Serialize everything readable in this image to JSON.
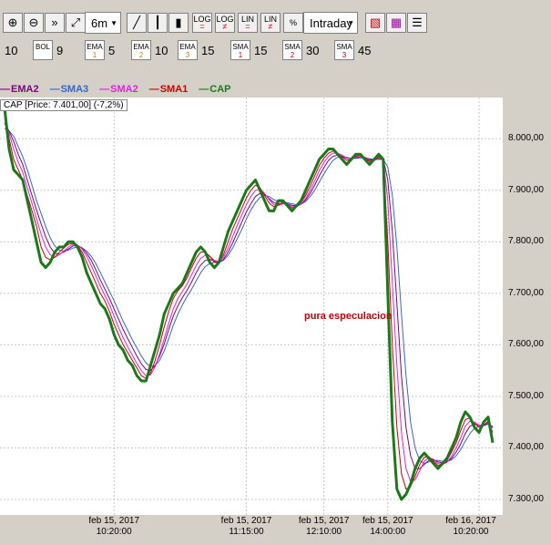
{
  "toolbar": {
    "timeframe": "6m",
    "session": "Intraday",
    "buttons": [
      {
        "name": "zoom-in-icon",
        "glyph": "⊕"
      },
      {
        "name": "zoom-out-icon",
        "glyph": "⊖"
      },
      {
        "name": "fast-forward-icon",
        "glyph": "»"
      },
      {
        "name": "fit-icon",
        "glyph": "⤢"
      }
    ],
    "chart_type_buttons": [
      {
        "name": "line-chart-icon",
        "glyph": "╱"
      },
      {
        "name": "bar-chart-icon",
        "glyph": "┃"
      },
      {
        "name": "candle-chart-icon",
        "glyph": "▮"
      }
    ],
    "scale_buttons": [
      {
        "name": "log-button",
        "top": "LOG",
        "bottom": "="
      },
      {
        "name": "log-neq-button",
        "top": "LOG",
        "bottom": "≠"
      },
      {
        "name": "lin-button",
        "top": "LIN",
        "bottom": "="
      },
      {
        "name": "lin-neq-button",
        "top": "LIN",
        "bottom": "≠"
      },
      {
        "name": "percent-button",
        "top": "%",
        "bottom": ""
      }
    ]
  },
  "indicators": [
    {
      "label": "",
      "sub": "",
      "value": "10"
    },
    {
      "label": "BOL",
      "sub": "",
      "value": "9"
    },
    {
      "label": "EMA",
      "sub": "1",
      "value": "5"
    },
    {
      "label": "EMA",
      "sub": "2",
      "value": "10"
    },
    {
      "label": "EMA",
      "sub": "3",
      "value": "15"
    },
    {
      "label": "SMA",
      "sub": "1",
      "value": "15"
    },
    {
      "label": "SMA",
      "sub": "2",
      "value": "30"
    },
    {
      "label": "SMA",
      "sub": "3",
      "value": "45"
    }
  ],
  "legend": [
    {
      "name": "EMA2",
      "color": "#800080"
    },
    {
      "name": "SMA3",
      "color": "#3366cc"
    },
    {
      "name": "SMA2",
      "color": "#e020e0"
    },
    {
      "name": "SMA1",
      "color": "#cc0000"
    },
    {
      "name": "CAP",
      "color": "#1a7a1a"
    }
  ],
  "price_label": "CAP [Price: 7.401,00] (-7,2%)",
  "annotation": "pura especulacion",
  "chart_data": {
    "type": "line",
    "ylim": [
      7270,
      8080
    ],
    "y_ticks": [
      {
        "value": 8000,
        "label": "8.000,00"
      },
      {
        "value": 7900,
        "label": "7.900,00"
      },
      {
        "value": 7800,
        "label": "7.800,00"
      },
      {
        "value": 7700,
        "label": "7.700,00"
      },
      {
        "value": 7600,
        "label": "7.600,00"
      },
      {
        "value": 7500,
        "label": "7.500,00"
      },
      {
        "value": 7400,
        "label": "7.400,00"
      },
      {
        "value": 7300,
        "label": "7.300,00"
      }
    ],
    "x_ticks": [
      {
        "idx": 24,
        "l1": "feb 15, 2017",
        "l2": "10:20:00"
      },
      {
        "idx": 53,
        "l1": "feb 15, 2017",
        "l2": "11:15:00"
      },
      {
        "idx": 70,
        "l1": "feb 15, 2017",
        "l2": "12:10:00"
      },
      {
        "idx": 84,
        "l1": "feb 15, 2017",
        "l2": "14:00:00"
      },
      {
        "idx": 104,
        "l1": "feb 16, 2017",
        "l2": "10:20:00"
      }
    ],
    "n_points": 108,
    "series": [
      {
        "name": "CAP",
        "color": "#1a7a1a",
        "width": 3,
        "values": [
          8060,
          7980,
          7940,
          7930,
          7920,
          7880,
          7840,
          7800,
          7760,
          7750,
          7760,
          7780,
          7790,
          7790,
          7800,
          7800,
          7790,
          7770,
          7740,
          7720,
          7700,
          7680,
          7670,
          7650,
          7620,
          7600,
          7590,
          7570,
          7560,
          7540,
          7530,
          7530,
          7560,
          7590,
          7620,
          7660,
          7680,
          7700,
          7710,
          7720,
          7740,
          7760,
          7780,
          7790,
          7780,
          7760,
          7750,
          7760,
          7790,
          7820,
          7840,
          7860,
          7880,
          7900,
          7910,
          7920,
          7900,
          7880,
          7860,
          7860,
          7880,
          7880,
          7870,
          7860,
          7870,
          7880,
          7900,
          7920,
          7940,
          7960,
          7970,
          7980,
          7980,
          7970,
          7960,
          7950,
          7960,
          7970,
          7970,
          7960,
          7950,
          7960,
          7970,
          7960,
          7700,
          7450,
          7320,
          7300,
          7310,
          7330,
          7360,
          7380,
          7390,
          7380,
          7370,
          7360,
          7370,
          7380,
          7400,
          7420,
          7450,
          7470,
          7460,
          7440,
          7430,
          7450,
          7460,
          7410
        ]
      },
      {
        "name": "SMA1",
        "color": "#cc0000",
        "width": 1,
        "values": [
          8050,
          8000,
          7960,
          7940,
          7920,
          7890,
          7860,
          7830,
          7790,
          7770,
          7765,
          7770,
          7780,
          7788,
          7795,
          7797,
          7793,
          7780,
          7760,
          7740,
          7720,
          7700,
          7685,
          7665,
          7640,
          7620,
          7600,
          7585,
          7570,
          7555,
          7540,
          7535,
          7545,
          7570,
          7600,
          7635,
          7665,
          7690,
          7705,
          7715,
          7730,
          7750,
          7768,
          7780,
          7780,
          7772,
          7760,
          7760,
          7775,
          7800,
          7825,
          7845,
          7865,
          7885,
          7900,
          7910,
          7905,
          7890,
          7875,
          7868,
          7872,
          7876,
          7872,
          7866,
          7868,
          7876,
          7890,
          7908,
          7928,
          7948,
          7962,
          7972,
          7976,
          7972,
          7965,
          7958,
          7960,
          7966,
          7968,
          7963,
          7956,
          7958,
          7964,
          7962,
          7800,
          7600,
          7440,
          7350,
          7320,
          7325,
          7345,
          7368,
          7382,
          7383,
          7375,
          7366,
          7368,
          7376,
          7392,
          7410,
          7434,
          7455,
          7458,
          7448,
          7440,
          7444,
          7452,
          7430
        ]
      },
      {
        "name": "SMA2",
        "color": "#e020e0",
        "width": 1,
        "values": [
          8040,
          8010,
          7980,
          7955,
          7935,
          7905,
          7875,
          7845,
          7815,
          7790,
          7775,
          7770,
          7775,
          7782,
          7790,
          7795,
          7794,
          7786,
          7772,
          7754,
          7734,
          7714,
          7696,
          7678,
          7656,
          7634,
          7614,
          7596,
          7580,
          7564,
          7550,
          7540,
          7542,
          7558,
          7582,
          7612,
          7642,
          7670,
          7690,
          7704,
          7718,
          7736,
          7754,
          7768,
          7774,
          7772,
          7764,
          7762,
          7770,
          7788,
          7810,
          7832,
          7852,
          7872,
          7888,
          7900,
          7902,
          7894,
          7882,
          7872,
          7870,
          7874,
          7873,
          7869,
          7868,
          7873,
          7884,
          7900,
          7918,
          7938,
          7954,
          7966,
          7972,
          7972,
          7968,
          7962,
          7961,
          7964,
          7966,
          7964,
          7958,
          7958,
          7962,
          7962,
          7880,
          7720,
          7560,
          7430,
          7360,
          7335,
          7338,
          7356,
          7374,
          7381,
          7378,
          7370,
          7368,
          7372,
          7384,
          7400,
          7420,
          7442,
          7452,
          7450,
          7444,
          7444,
          7450,
          7438
        ]
      },
      {
        "name": "EMA2",
        "color": "#800080",
        "width": 1,
        "values": [
          8030,
          8015,
          7995,
          7970,
          7950,
          7920,
          7890,
          7862,
          7835,
          7810,
          7790,
          7778,
          7776,
          7780,
          7786,
          7792,
          7793,
          7788,
          7778,
          7764,
          7746,
          7726,
          7708,
          7690,
          7670,
          7650,
          7630,
          7612,
          7595,
          7578,
          7563,
          7552,
          7550,
          7560,
          7578,
          7602,
          7630,
          7656,
          7676,
          7692,
          7706,
          7722,
          7740,
          7755,
          7764,
          7766,
          7762,
          7760,
          7766,
          7780,
          7798,
          7818,
          7838,
          7858,
          7874,
          7888,
          7894,
          7892,
          7884,
          7876,
          7874,
          7875,
          7874,
          7871,
          7870,
          7873,
          7881,
          7894,
          7910,
          7928,
          7944,
          7958,
          7966,
          7968,
          7966,
          7962,
          7961,
          7963,
          7965,
          7964,
          7960,
          7959,
          7961,
          7961,
          7920,
          7820,
          7680,
          7540,
          7440,
          7385,
          7360,
          7360,
          7368,
          7376,
          7377,
          7373,
          7371,
          7373,
          7380,
          7392,
          7408,
          7428,
          7442,
          7446,
          7444,
          7444,
          7448,
          7440
        ]
      },
      {
        "name": "SMA3",
        "color": "#3366cc",
        "width": 1,
        "values": [
          8020,
          8015,
          8005,
          7985,
          7965,
          7940,
          7910,
          7880,
          7855,
          7830,
          7808,
          7792,
          7784,
          7782,
          7784,
          7788,
          7790,
          7788,
          7782,
          7772,
          7758,
          7740,
          7722,
          7704,
          7686,
          7666,
          7646,
          7628,
          7610,
          7594,
          7578,
          7565,
          7558,
          7560,
          7570,
          7588,
          7612,
          7638,
          7660,
          7678,
          7694,
          7708,
          7724,
          7740,
          7752,
          7758,
          7760,
          7760,
          7764,
          7774,
          7788,
          7806,
          7824,
          7844,
          7862,
          7876,
          7886,
          7890,
          7888,
          7882,
          7878,
          7877,
          7876,
          7874,
          7872,
          7873,
          7878,
          7888,
          7900,
          7916,
          7932,
          7946,
          7958,
          7964,
          7966,
          7964,
          7962,
          7962,
          7963,
          7963,
          7961,
          7960,
          7960,
          7960,
          7945,
          7890,
          7790,
          7660,
          7540,
          7450,
          7400,
          7375,
          7370,
          7373,
          7376,
          7376,
          7374,
          7374,
          7377,
          7385,
          7397,
          7413,
          7428,
          7438,
          7442,
          7443,
          7446,
          7442
        ]
      }
    ]
  }
}
